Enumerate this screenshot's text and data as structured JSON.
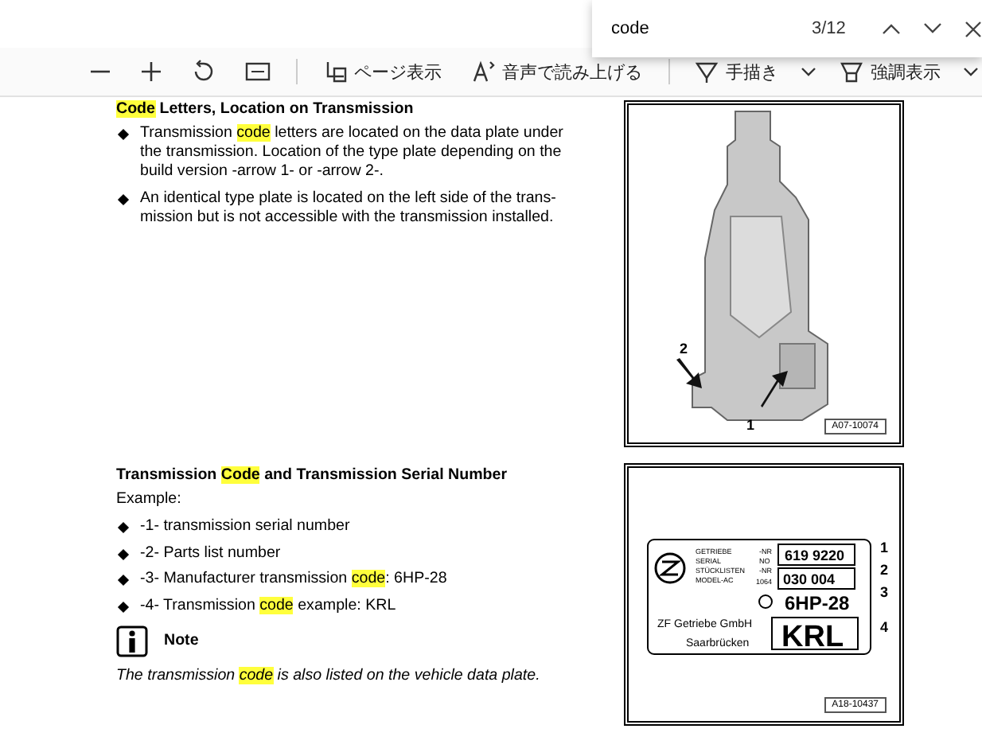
{
  "find": {
    "query": "code",
    "count": "3/12"
  },
  "toolbar": [
    {
      "kind": "zoom-out"
    },
    {
      "kind": "zoom-in"
    },
    {
      "kind": "rotate"
    },
    {
      "kind": "fit"
    },
    {
      "kind": "divider"
    },
    {
      "kind": "page-view",
      "label": "ページ表示"
    },
    {
      "kind": "read-aloud",
      "label": "音声で読み上げる"
    },
    {
      "kind": "divider"
    },
    {
      "kind": "draw",
      "label": "手描き"
    },
    {
      "kind": "caret"
    },
    {
      "kind": "highlight",
      "label": "強調表示"
    },
    {
      "kind": "caret"
    }
  ],
  "section1": {
    "heading": [
      {
        "text": "Code",
        "highlighted": true
      },
      {
        "text": " Letters, Location on Transmission",
        "highlighted": false
      }
    ],
    "bullets": [
      [
        {
          "text": "Transmission ",
          "highlighted": false
        },
        {
          "text": "code",
          "highlighted": true
        },
        {
          "text": " letters are located on the data plate under the transmission. Location of the type plate depending on the build version -arrow 1- or -arrow 2-.",
          "highlighted": false
        }
      ],
      [
        {
          "text": "An identical type plate is located on the left side of the trans-mission but is not accessible with the transmission installed.",
          "highlighted": false
        }
      ]
    ]
  },
  "section2": {
    "heading": [
      {
        "text": "Transmission ",
        "highlighted": false
      },
      {
        "text": "Code",
        "highlighted": true
      },
      {
        "text": " and Transmission Serial Number",
        "highlighted": false
      }
    ],
    "intro": "Example:",
    "bullets": [
      [
        {
          "text": "-1- transmission serial number",
          "highlighted": false
        }
      ],
      [
        {
          "text": "-2- Parts list number",
          "highlighted": false
        }
      ],
      [
        {
          "text": "-3- Manufacturer transmission ",
          "highlighted": false
        },
        {
          "text": "code",
          "highlighted": true
        },
        {
          "text": ": 6HP-28",
          "highlighted": false
        }
      ],
      [
        {
          "text": "-4- Transmission ",
          "highlighted": false
        },
        {
          "text": "code",
          "highlighted": true
        },
        {
          "text": " example: KRL",
          "highlighted": false
        }
      ]
    ],
    "note_title": "Note",
    "note": [
      {
        "text": "The transmission ",
        "highlighted": false
      },
      {
        "text": "code",
        "highlighted": true
      },
      {
        "text": " is also listed on the vehicle data plate.",
        "highlighted": false
      }
    ]
  },
  "figure1": {
    "callouts": [
      "2",
      "1"
    ],
    "ref": "A07-10074"
  },
  "figure2": {
    "plate_labels": [
      "GETRIEBE",
      "SERIAL",
      "STÜCKLISTEN",
      "MODEL-AC"
    ],
    "plate_suffixes": [
      "-NR",
      "NO",
      "-NR"
    ],
    "serial": "619 9220",
    "parts_prefix": "1064",
    "parts": "030 004",
    "model": "6HP-28",
    "maker": "ZF Getriebe GmbH",
    "city": "Saarbrücken",
    "code": "KRL",
    "callouts": [
      "1",
      "2",
      "3",
      "4"
    ],
    "ref": "A18-10437"
  }
}
